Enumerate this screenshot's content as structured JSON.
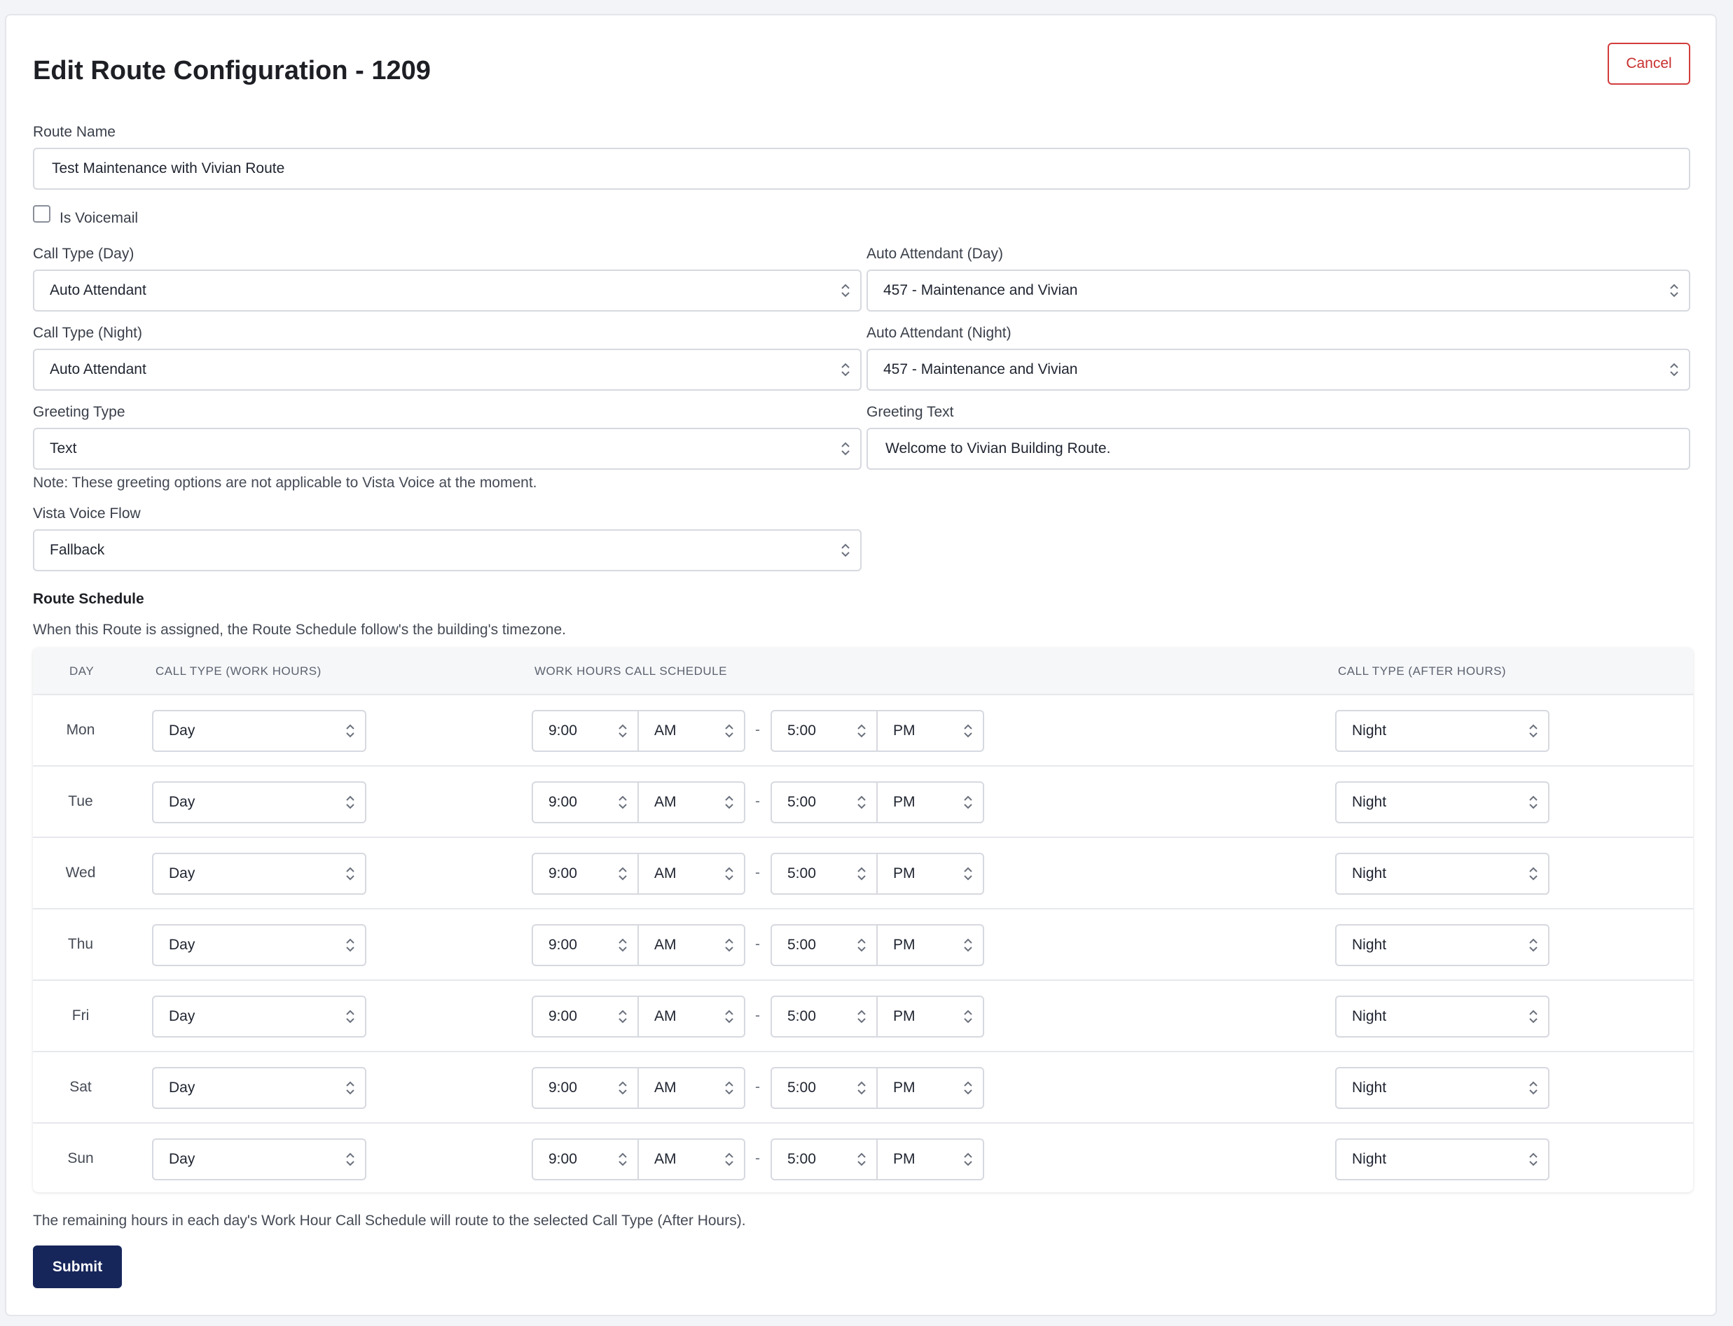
{
  "header": {
    "title": "Edit Route Configuration - 1209",
    "cancel_label": "Cancel"
  },
  "form": {
    "route_name_label": "Route Name",
    "route_name_value": "Test Maintenance with Vivian Route",
    "is_voicemail_label": "Is Voicemail",
    "is_voicemail_checked": false,
    "call_type_day_label": "Call Type (Day)",
    "call_type_day_value": "Auto Attendant",
    "auto_attendant_day_label": "Auto Attendant (Day)",
    "auto_attendant_day_value": "457 - Maintenance and Vivian",
    "call_type_night_label": "Call Type (Night)",
    "call_type_night_value": "Auto Attendant",
    "auto_attendant_night_label": "Auto Attendant (Night)",
    "auto_attendant_night_value": "457 - Maintenance and Vivian",
    "greeting_type_label": "Greeting Type",
    "greeting_type_value": "Text",
    "greeting_text_label": "Greeting Text",
    "greeting_text_value": "Welcome to Vivian Building Route.",
    "greeting_note": "Note: These greeting options are not applicable to Vista Voice at the moment.",
    "vista_voice_flow_label": "Vista Voice Flow",
    "vista_voice_flow_value": "Fallback"
  },
  "schedule": {
    "title": "Route Schedule",
    "description": "When this Route is assigned, the Route Schedule follow's the building's timezone.",
    "headers": {
      "day": "DAY",
      "call_type_work": "CALL TYPE (WORK HOURS)",
      "work_hours": "WORK HOURS CALL SCHEDULE",
      "call_type_after": "CALL TYPE (AFTER HOURS)"
    },
    "separator": "-",
    "rows": [
      {
        "day": "Mon",
        "work_type": "Day",
        "start_time": "9:00",
        "start_ampm": "AM",
        "end_time": "5:00",
        "end_ampm": "PM",
        "after_type": "Night"
      },
      {
        "day": "Tue",
        "work_type": "Day",
        "start_time": "9:00",
        "start_ampm": "AM",
        "end_time": "5:00",
        "end_ampm": "PM",
        "after_type": "Night"
      },
      {
        "day": "Wed",
        "work_type": "Day",
        "start_time": "9:00",
        "start_ampm": "AM",
        "end_time": "5:00",
        "end_ampm": "PM",
        "after_type": "Night"
      },
      {
        "day": "Thu",
        "work_type": "Day",
        "start_time": "9:00",
        "start_ampm": "AM",
        "end_time": "5:00",
        "end_ampm": "PM",
        "after_type": "Night"
      },
      {
        "day": "Fri",
        "work_type": "Day",
        "start_time": "9:00",
        "start_ampm": "AM",
        "end_time": "5:00",
        "end_ampm": "PM",
        "after_type": "Night"
      },
      {
        "day": "Sat",
        "work_type": "Day",
        "start_time": "9:00",
        "start_ampm": "AM",
        "end_time": "5:00",
        "end_ampm": "PM",
        "after_type": "Night"
      },
      {
        "day": "Sun",
        "work_type": "Day",
        "start_time": "9:00",
        "start_ampm": "AM",
        "end_time": "5:00",
        "end_ampm": "PM",
        "after_type": "Night"
      }
    ],
    "footer_note": "The remaining hours in each day's Work Hour Call Schedule will route to the selected Call Type (After Hours)."
  },
  "actions": {
    "submit_label": "Submit"
  },
  "colors": {
    "primary": "#17265a",
    "danger": "#c8302f"
  },
  "icons": {
    "select_chevron": "chevron-up-down-icon"
  }
}
